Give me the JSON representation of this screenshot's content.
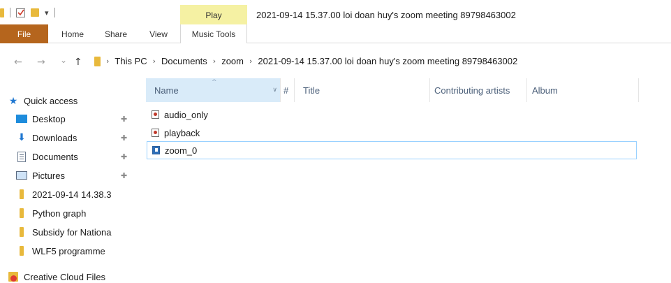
{
  "titlebar": {
    "context_tab": "Play",
    "window_title": "2021-09-14 15.37.00 loi doan huy's zoom meeting 89798463002",
    "qat_dropdown": "▾"
  },
  "ribbon": {
    "tabs": [
      {
        "label": "File"
      },
      {
        "label": "Home"
      },
      {
        "label": "Share"
      },
      {
        "label": "View"
      },
      {
        "label": "Music Tools"
      }
    ]
  },
  "nav": {
    "back": "←",
    "forward": "→",
    "recent": "⌄",
    "up": "↑"
  },
  "address": {
    "crumbs": [
      "This PC",
      "Documents",
      "zoom",
      "2021-09-14 15.37.00 loi doan huy's zoom meeting 89798463002"
    ]
  },
  "navpane": {
    "quick_access": "Quick access",
    "items": [
      {
        "label": "Desktop",
        "icon": "desktop-icon"
      },
      {
        "label": "Downloads",
        "icon": "download-icon"
      },
      {
        "label": "Documents",
        "icon": "documents-icon"
      },
      {
        "label": "Pictures",
        "icon": "pictures-icon"
      },
      {
        "label": "2021-09-14 14.38.3",
        "icon": "folder-icon"
      },
      {
        "label": "Python graph",
        "icon": "folder-icon"
      },
      {
        "label": "Subsidy for Nationa",
        "icon": "folder-icon"
      },
      {
        "label": "WLF5 programme",
        "icon": "folder-icon"
      }
    ],
    "creative_cloud": "Creative Cloud Files"
  },
  "columns": {
    "name": "Name",
    "number": "#",
    "title": "Title",
    "contributing_artists": "Contributing artists",
    "album": "Album"
  },
  "files": [
    {
      "name": "audio_only",
      "type": "audio"
    },
    {
      "name": "playback",
      "type": "audio"
    },
    {
      "name": "zoom_0",
      "type": "video",
      "selected": true
    }
  ],
  "colors": {
    "file_tab": "#b5651d",
    "context_tab": "#f5f1a3",
    "selection_border": "#99d1ff",
    "column_highlight": "#d9ebf9"
  }
}
